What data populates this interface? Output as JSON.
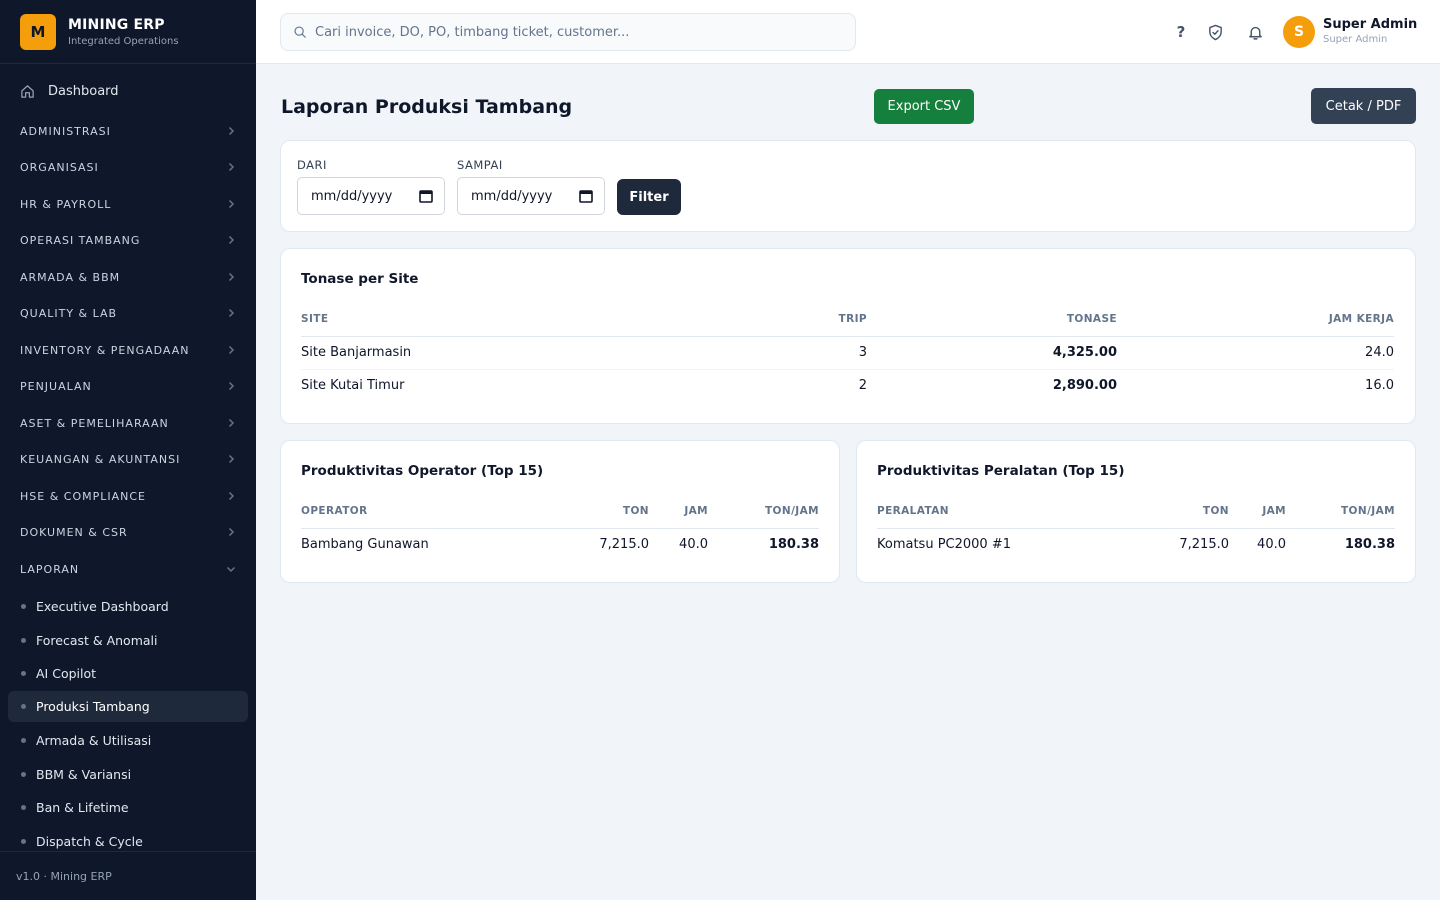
{
  "brand": {
    "logo_letter": "M",
    "name": "MINING ERP",
    "subtitle": "Integrated Operations"
  },
  "sidebar": {
    "dashboard_label": "Dashboard",
    "groups": [
      "ADMINISTRASI",
      "ORGANISASI",
      "HR & PAYROLL",
      "OPERASI TAMBANG",
      "ARMADA & BBM",
      "QUALITY & LAB",
      "INVENTORY & PENGADAAN",
      "PENJUALAN",
      "ASET & PEMELIHARAAN",
      "KEUANGAN & AKUNTANSI",
      "HSE & COMPLIANCE",
      "DOKUMEN & CSR",
      "LAPORAN"
    ],
    "laporan_items": [
      "Executive Dashboard",
      "Forecast & Anomali",
      "AI Copilot",
      "Produksi Tambang",
      "Armada & Utilisasi",
      "BBM & Variansi",
      "Ban & Lifetime",
      "Dispatch & Cycle"
    ],
    "active_item": "Produksi Tambang",
    "footer": "v1.0 · Mining ERP"
  },
  "topbar": {
    "search_placeholder": "Cari invoice, DO, PO, timbang ticket, customer...",
    "help_glyph": "?",
    "avatar_letter": "S",
    "user_name": "Super Admin",
    "user_role": "Super Admin"
  },
  "page": {
    "title": "Laporan Produksi Tambang",
    "export_label": "Export CSV",
    "print_label": "Cetak / PDF"
  },
  "filter": {
    "from_label": "DARI",
    "to_label": "SAMPAI",
    "date_placeholder": "mm/dd/yyyy",
    "button_label": "Filter"
  },
  "site_table": {
    "title": "Tonase per Site",
    "headers": [
      "SITE",
      "TRIP",
      "TONASE",
      "JAM KERJA"
    ],
    "rows": [
      [
        "Site Banjarmasin",
        "3",
        "4,325.00",
        "24.0"
      ],
      [
        "Site Kutai Timur",
        "2",
        "2,890.00",
        "16.0"
      ]
    ]
  },
  "operator_table": {
    "title": "Produktivitas Operator (Top 15)",
    "headers": [
      "OPERATOR",
      "TON",
      "JAM",
      "TON/JAM"
    ],
    "rows": [
      [
        "Bambang Gunawan",
        "7,215.0",
        "40.0",
        "180.38"
      ]
    ]
  },
  "equipment_table": {
    "title": "Produktivitas Peralatan (Top 15)",
    "headers": [
      "PERALATAN",
      "TON",
      "JAM",
      "TON/JAM"
    ],
    "rows": [
      [
        "Komatsu PC2000 #1",
        "7,215.0",
        "40.0",
        "180.38"
      ]
    ]
  },
  "colors": {
    "sidebar_bg": "#0f172a",
    "accent": "#f59e0b",
    "export_green": "#15803d",
    "dark_button": "#334155"
  }
}
